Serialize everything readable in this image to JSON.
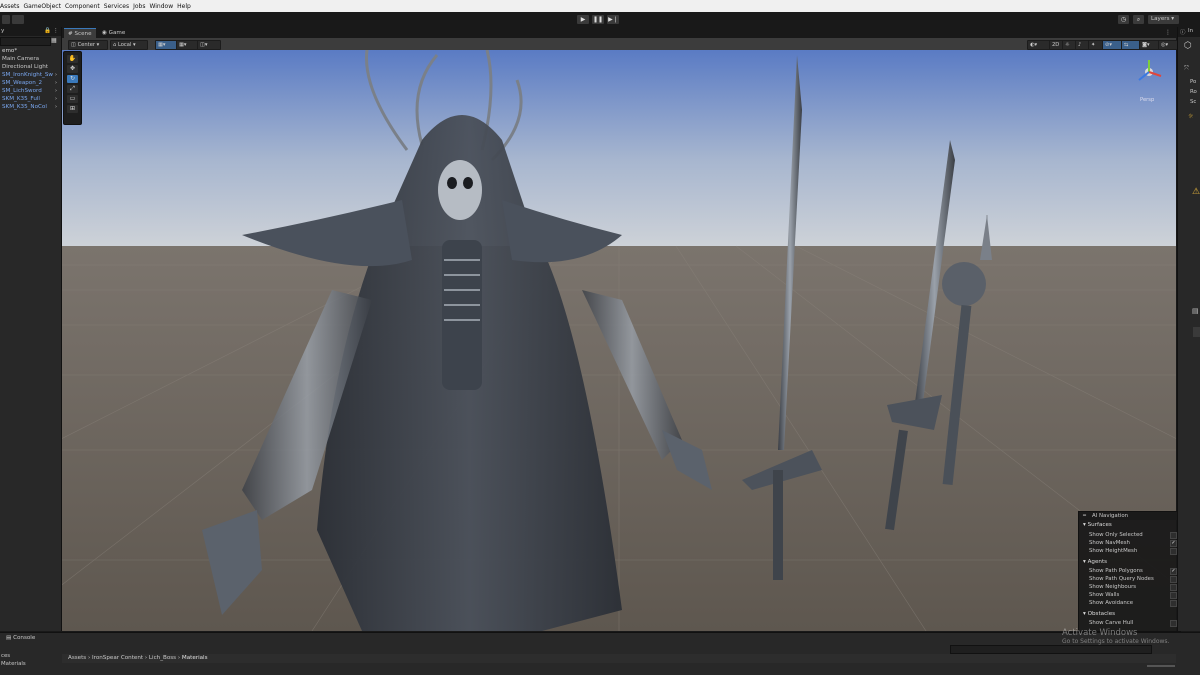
{
  "menubar": {
    "items": [
      "Assets",
      "GameObject",
      "Component",
      "Services",
      "Jobs",
      "Window",
      "Help"
    ]
  },
  "toolbar": {
    "layers_label": "Layers"
  },
  "hierarchy": {
    "scene_name": "emo*",
    "items": [
      {
        "label": "Main Camera",
        "prefab": false
      },
      {
        "label": "Directional Light",
        "prefab": false
      },
      {
        "label": "SM_IronKnight_Sw",
        "prefab": true
      },
      {
        "label": "SM_Weapon_2",
        "prefab": true
      },
      {
        "label": "SM_LichSword",
        "prefab": true
      },
      {
        "label": "SKM_K35_Full",
        "prefab": true
      },
      {
        "label": "SKM_K35_NoCol",
        "prefab": true
      }
    ]
  },
  "scene": {
    "tabs": [
      "Scene",
      "Game"
    ],
    "pivot_label": "Center",
    "space_label": "Local",
    "gizmo_label": "Persp"
  },
  "ai_navigation": {
    "title": "AI Navigation",
    "sections": [
      {
        "header": "Surfaces",
        "rows": [
          {
            "label": "Show Only Selected",
            "checked": false
          },
          {
            "label": "Show NavMesh",
            "checked": true
          },
          {
            "label": "Show HeightMesh",
            "checked": false
          }
        ]
      },
      {
        "header": "Agents",
        "rows": [
          {
            "label": "Show Path Polygons",
            "checked": true
          },
          {
            "label": "Show Path Query Nodes",
            "checked": false
          },
          {
            "label": "Show Neighbours",
            "checked": false
          },
          {
            "label": "Show Walls",
            "checked": false
          },
          {
            "label": "Show Avoidance",
            "checked": false
          }
        ]
      },
      {
        "header": "Obstacles",
        "rows": [
          {
            "label": "Show Carve Hull",
            "checked": false
          }
        ]
      }
    ]
  },
  "console": {
    "label": "Console"
  },
  "project": {
    "left_items": [
      "ces",
      "Materials"
    ],
    "breadcrumb": [
      "Assets",
      "IronSpear Content",
      "Lich_Boss",
      "Materials"
    ]
  },
  "inspector": {
    "tab_label": "In",
    "fields": [
      "Po",
      "Ro",
      "Sc"
    ]
  },
  "watermark": {
    "line1": "Activate Windows",
    "line2": "Go to Settings to activate Windows."
  },
  "colors": {
    "sky_top": "#5a7bc4",
    "sky_horizon": "#c8d0da",
    "ground": "#6c655c",
    "panel": "#282828",
    "prefab_text": "#7aa7f0",
    "accent": "#3a79bb"
  }
}
